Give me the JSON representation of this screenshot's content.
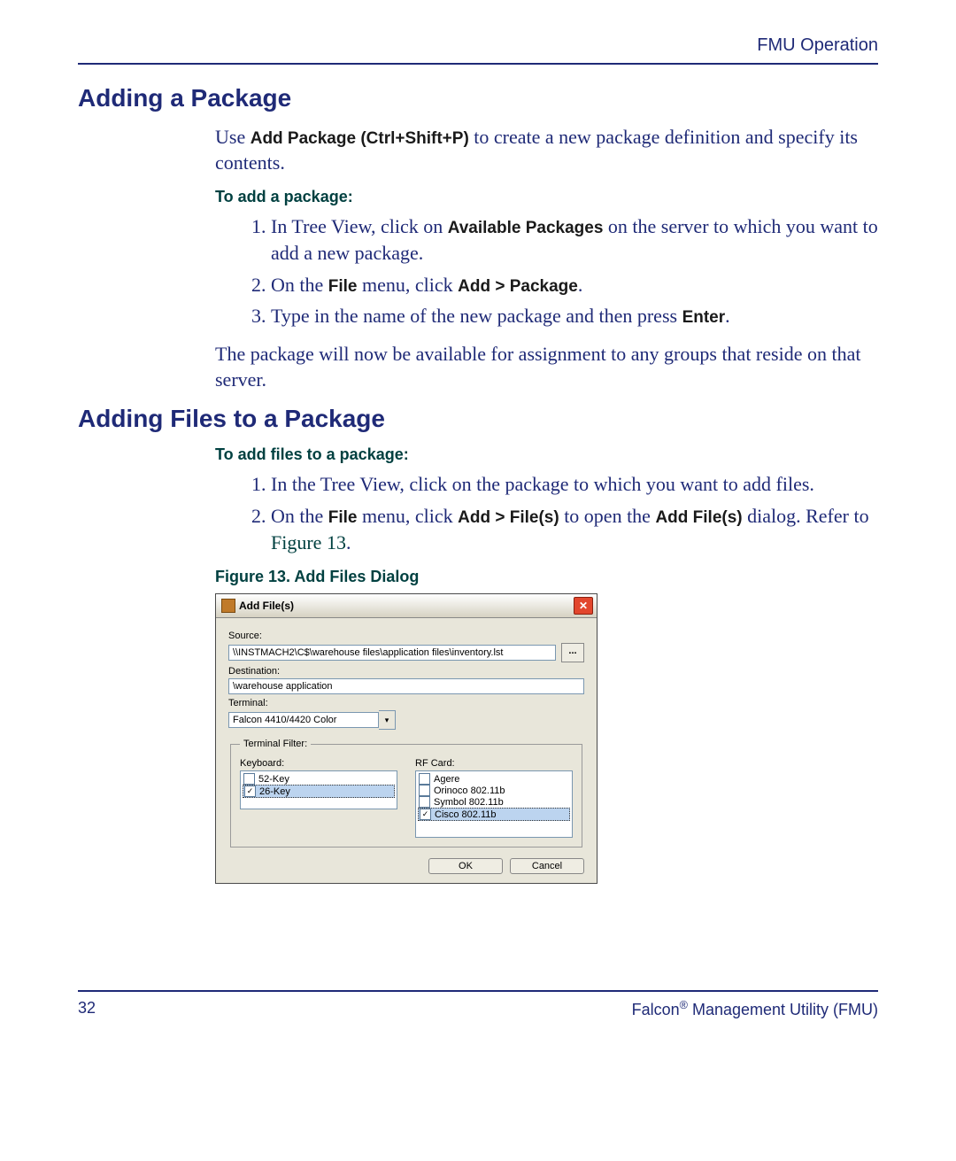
{
  "header": {
    "right": "FMU Operation"
  },
  "section1": {
    "title": "Adding a Package",
    "intro_pre": "Use ",
    "intro_bold": "Add Package (Ctrl+Shift+P)",
    "intro_post": " to create a new package definition and specify its contents.",
    "sub": "To add a package:",
    "step1_pre": "In Tree View, click on ",
    "step1_bold": "Available Packages",
    "step1_post": " on the server to which you want to add a new package.",
    "step2_pre": "On the ",
    "step2_b1": "File",
    "step2_mid": " menu, click ",
    "step2_b2": "Add > Package",
    "step2_post": ".",
    "step3_pre": "Type in the name of the new package and then press ",
    "step3_bold": "Enter",
    "step3_post": ".",
    "outro": "The package will now be available for assignment to any groups that reside on that server."
  },
  "section2": {
    "title": "Adding Files to a Package",
    "sub": "To add files to a package:",
    "step1": "In the Tree View, click on the package to which you want to add files.",
    "step2_pre": "On the ",
    "step2_b1": "File",
    "step2_mid": " menu, click ",
    "step2_b2": "Add > File(s)",
    "step2_mid2": " to open the ",
    "step2_b3": "Add File(s)",
    "step2_post": " dialog. Refer to ",
    "step2_ref": "Figure 13",
    "figcap": "Figure 13. Add Files Dialog"
  },
  "dialog": {
    "title": "Add File(s)",
    "source_label": "Source:",
    "source_value": "\\\\INSTMACH2\\C$\\warehouse files\\application files\\inventory.lst",
    "dest_label": "Destination:",
    "dest_value": "\\warehouse application",
    "term_label": "Terminal:",
    "term_value": "Falcon 4410/4420 Color",
    "filter_legend": "Terminal Filter:",
    "kbd_label": "Keyboard:",
    "rf_label": "RF Card:",
    "kbd_items": [
      {
        "label": "52-Key",
        "checked": false,
        "selected": false
      },
      {
        "label": "26-Key",
        "checked": true,
        "selected": true
      }
    ],
    "rf_items": [
      {
        "label": "Agere",
        "checked": false,
        "selected": false
      },
      {
        "label": "Orinoco 802.11b",
        "checked": false,
        "selected": false
      },
      {
        "label": "Symbol 802.11b",
        "checked": false,
        "selected": false
      },
      {
        "label": "Cisco 802.11b",
        "checked": true,
        "selected": true
      }
    ],
    "ok": "OK",
    "cancel": "Cancel",
    "browse": "..."
  },
  "footer": {
    "page": "32",
    "product_pre": "Falcon",
    "product_post": " Management Utility (FMU)"
  }
}
